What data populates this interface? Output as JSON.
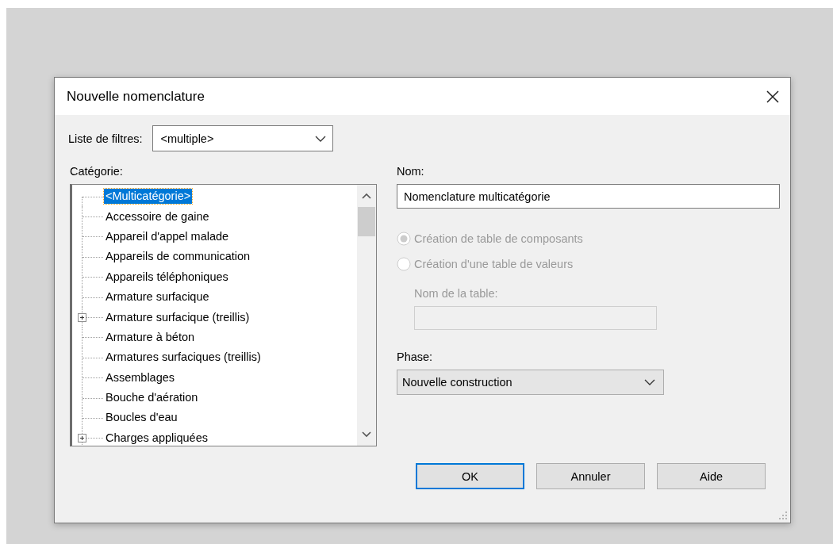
{
  "window": {
    "title": "Nouvelle nomenclature"
  },
  "filter": {
    "label": "Liste de filtres:",
    "value": "<multiple>"
  },
  "category": {
    "label": "Catégorie:",
    "items": [
      {
        "label": "<Multicatégorie>",
        "kind": "leaf",
        "selected": true
      },
      {
        "label": "Accessoire de gaine",
        "kind": "leaf",
        "selected": false
      },
      {
        "label": "Appareil d'appel malade",
        "kind": "leaf",
        "selected": false
      },
      {
        "label": "Appareils de communication",
        "kind": "leaf",
        "selected": false
      },
      {
        "label": "Appareils téléphoniques",
        "kind": "leaf",
        "selected": false
      },
      {
        "label": "Armature surfacique",
        "kind": "leaf",
        "selected": false
      },
      {
        "label": "Armature surfacique (treillis)",
        "kind": "collapsed",
        "selected": false
      },
      {
        "label": "Armature à béton",
        "kind": "leaf",
        "selected": false
      },
      {
        "label": "Armatures surfaciques (treillis)",
        "kind": "leaf",
        "selected": false
      },
      {
        "label": "Assemblages",
        "kind": "leaf",
        "selected": false
      },
      {
        "label": "Bouche d'aération",
        "kind": "leaf",
        "selected": false
      },
      {
        "label": "Boucles d'eau",
        "kind": "leaf",
        "selected": false
      },
      {
        "label": "Charges appliquées",
        "kind": "collapsed",
        "selected": false
      }
    ]
  },
  "name": {
    "label": "Nom:",
    "value": "Nomenclature multicatégorie"
  },
  "options": [
    {
      "label": "Création de table de composants",
      "selected": true,
      "disabled": true
    },
    {
      "label": "Création d'une table de valeurs",
      "selected": false,
      "disabled": true
    }
  ],
  "table_name": {
    "label": "Nom de la table:",
    "disabled": true
  },
  "phase": {
    "label": "Phase:",
    "value": "Nouvelle construction"
  },
  "buttons": [
    {
      "label": "OK",
      "default": true
    },
    {
      "label": "Annuler",
      "default": false
    },
    {
      "label": "Aide",
      "default": false
    }
  ]
}
